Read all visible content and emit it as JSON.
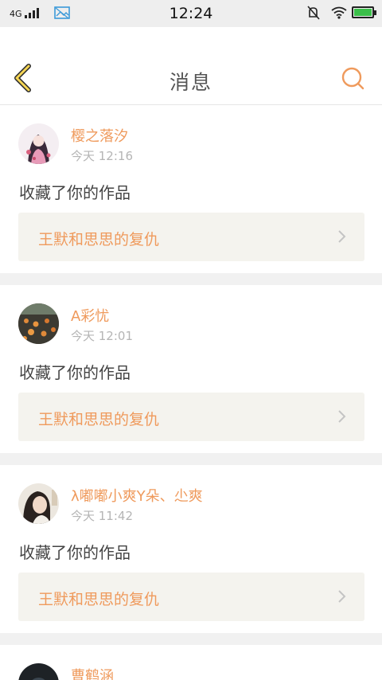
{
  "status_bar": {
    "network": "4G",
    "time": "12:24"
  },
  "nav": {
    "title": "消息",
    "back_icon": "back-chevron-icon",
    "search_icon": "search-icon"
  },
  "accent_color": "#ef9a5c",
  "messages": [
    {
      "user": "樱之落汐",
      "time": "今天 12:16",
      "action": "收藏了你的作品",
      "work": "王默和思思的复仇"
    },
    {
      "user": "A彩忧",
      "time": "今天 12:01",
      "action": "收藏了你的作品",
      "work": "王默和思思的复仇"
    },
    {
      "user": "λ嘟嘟小爽Y朵、尐爽",
      "time": "今天 11:42",
      "action": "收藏了你的作品",
      "work": "王默和思思的复仇"
    },
    {
      "user": "曹鹤涵"
    }
  ]
}
